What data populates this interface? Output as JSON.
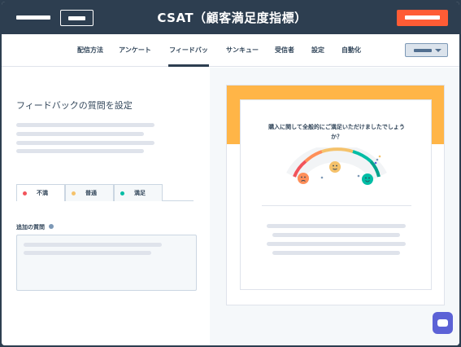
{
  "header": {
    "title": "CSAT（顧客満足度指標）"
  },
  "nav": {
    "tabs": [
      {
        "label": "配信方法",
        "active": false
      },
      {
        "label": "アンケート",
        "active": false
      },
      {
        "label": "フィードバック",
        "active": true
      },
      {
        "label": "サンキュー",
        "active": false
      },
      {
        "label": "受信者",
        "active": false
      },
      {
        "label": "設定",
        "active": false
      },
      {
        "label": "自動化",
        "active": false
      }
    ]
  },
  "editor": {
    "section_title": "フィードバックの質問を設定",
    "sentiment_tabs": [
      {
        "label": "不満",
        "color": "#f2545b",
        "active": true
      },
      {
        "label": "普通",
        "color": "#f5c26b",
        "active": false
      },
      {
        "label": "満足",
        "color": "#00bda5",
        "active": false
      }
    ],
    "additional_question_label": "追加の質問"
  },
  "preview": {
    "question": "購入に関して全般的にご満足いただけましたでしょうか？",
    "band_color": "#ffb547"
  },
  "icons": {
    "chat": "chat-icon",
    "dropdown": "chevron-down-icon",
    "info": "info-icon",
    "faces": [
      "sad-face-icon",
      "neutral-face-icon",
      "happy-face-icon"
    ]
  }
}
